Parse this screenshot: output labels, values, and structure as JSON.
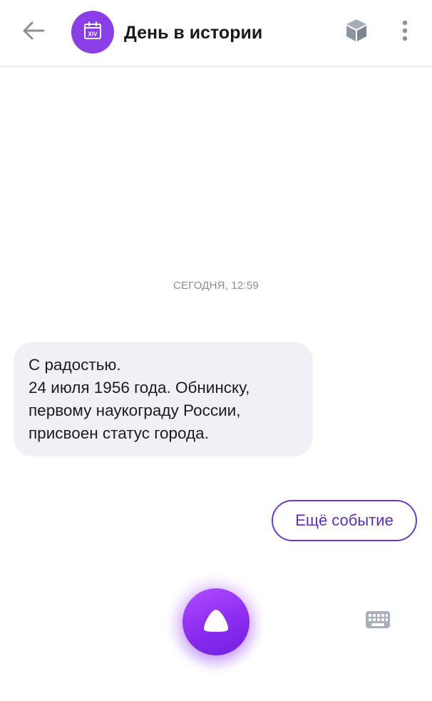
{
  "header": {
    "back_icon": "arrow-left-icon",
    "avatar_icon": "calendar-icon",
    "avatar_text": "XIV",
    "title": "День в истории",
    "skill_icon": "cube-icon",
    "more_icon": "more-vertical-icon"
  },
  "chat": {
    "timestamp": "СЕГОДНЯ, 12:59",
    "message": {
      "lines": [
        "С радостью.",
        "24 июля 1956 года. Обнинску,",
        "первому наукограду России,",
        "присвоен статус города."
      ]
    },
    "suggest_button": "Ещё событие"
  },
  "footer": {
    "alice_icon": "alice-icon",
    "keyboard_icon": "keyboard-icon"
  },
  "colors": {
    "accent": "#8a3ee8",
    "suggest_border": "#6839cf",
    "bubble_bg": "#f1f1f4"
  }
}
